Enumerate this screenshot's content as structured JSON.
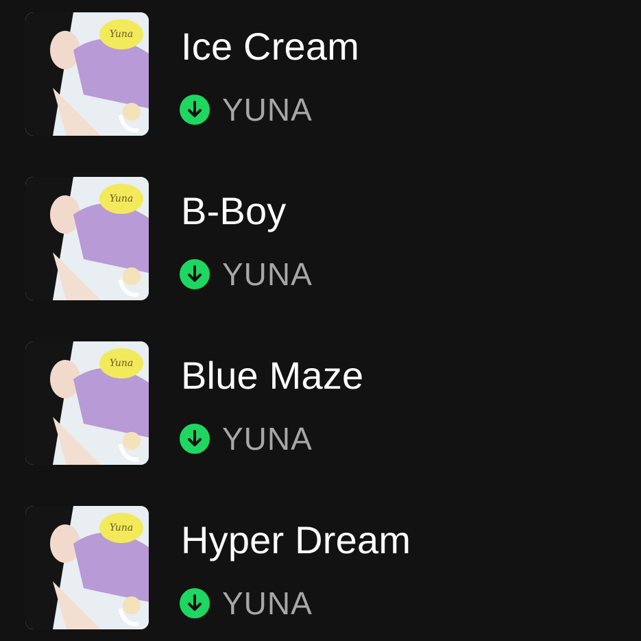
{
  "colors": {
    "background": "#121212",
    "title": "#ffffff",
    "artist": "#a7a7a7",
    "downloaded_accent": "#1ed760"
  },
  "tracks": [
    {
      "title": "Ice Cream",
      "artist": "YUNA",
      "status_icon": "download-complete-icon",
      "cover_icon": "album-art"
    },
    {
      "title": "B-Boy",
      "artist": "YUNA",
      "status_icon": "download-complete-icon",
      "cover_icon": "album-art"
    },
    {
      "title": "Blue Maze",
      "artist": "YUNA",
      "status_icon": "download-complete-icon",
      "cover_icon": "album-art"
    },
    {
      "title": "Hyper Dream",
      "artist": "YUNA",
      "status_icon": "download-complete-icon",
      "cover_icon": "album-art"
    }
  ]
}
